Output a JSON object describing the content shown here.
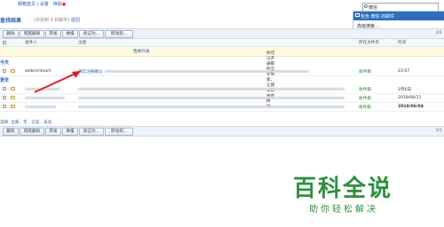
{
  "top_links": {
    "inbox_home": "邮箱首页",
    "settings": "设置",
    "switch": "换肤"
  },
  "search": {
    "query": "微信",
    "dropdown_selected": "包含 微信 的邮件",
    "dropdown_other": "高级搜索..."
  },
  "results": {
    "title": "查找结果",
    "subtitle_prefix": "(共找到",
    "count": "3",
    "subtitle_suffix": "封邮件)",
    "back_link": "返回"
  },
  "toolbar": {
    "buttons": [
      "删除",
      "彻底删除",
      "转发",
      "举报",
      "标记为...",
      "移动到..."
    ],
    "pager": "1/1"
  },
  "columns": {
    "sender": "发件人",
    "subject": "主题",
    "folder": "所在文件夹",
    "time": "时间"
  },
  "notice": {
    "text": "你可以开通邮件全文搜索，让搜索结果更精准。",
    "link": "我要开通"
  },
  "groups": {
    "today": "今天",
    "earlier": "更早"
  },
  "rows": [
    {
      "sender": "webcenteam",
      "subject": "微信注册确认",
      "folder": "收件箱",
      "time": "23:07"
    },
    {
      "sender": "",
      "subject": "",
      "folder": "收件箱",
      "time": "2月6日"
    },
    {
      "sender": "",
      "subject": "",
      "folder": "收件箱",
      "time": "2018/08/11"
    },
    {
      "sender": "",
      "subject": "",
      "folder": "收件箱",
      "time": "2018/06/04"
    }
  ],
  "select_bar": {
    "label": "选择:",
    "all": "全部",
    "none": "无",
    "read": "已读",
    "unread": "未读"
  },
  "watermark": {
    "brand": "百科全说",
    "slogan": "助你轻松解决"
  }
}
